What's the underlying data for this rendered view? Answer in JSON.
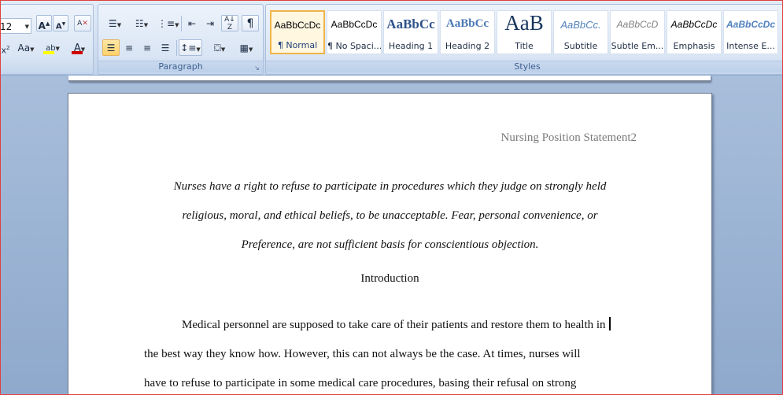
{
  "ribbon": {
    "font_size": "12",
    "paragraph_label": "Paragraph",
    "styles_label": "Styles",
    "styles": [
      {
        "preview": "AaBbCcDc",
        "name": "¶ Normal",
        "active": true
      },
      {
        "preview": "AaBbCcDc",
        "name": "¶ No Spaci..."
      },
      {
        "preview": "AaBbCc",
        "name": "Heading 1"
      },
      {
        "preview": "AaBbCc",
        "name": "Heading 2"
      },
      {
        "preview": "AaB",
        "name": "Title"
      },
      {
        "preview": "AaBbCc.",
        "name": "Subtitle"
      },
      {
        "preview": "AaBbCcD",
        "name": "Subtle Em..."
      },
      {
        "preview": "AaBbCcDc",
        "name": "Emphasis"
      },
      {
        "preview": "AaBbCcDc",
        "name": "Intense E..."
      }
    ]
  },
  "document": {
    "header": "Nursing Position Statement2",
    "abstract_lines": [
      "Nurses have a right to refuse to participate in procedures which they judge on strongly held",
      "religious, moral, and ethical beliefs, to be unacceptable. Fear, personal convenience, or",
      "Preference, are not sufficient basis for conscientious objection."
    ],
    "heading": "Introduction",
    "body_lines": [
      "Medical personnel are supposed to take care of their patients and restore them to health in",
      "the best way they know how. However, this can not always be the case. At times, nurses will",
      "have to refuse to participate in some medical care procedures, basing their refusal on strong"
    ]
  },
  "colors": {
    "accent": "#f0b44a",
    "ribbon_text": "#3d5f8f",
    "font_color_bar": "#d00000",
    "highlight_bar": "#ffff00"
  }
}
